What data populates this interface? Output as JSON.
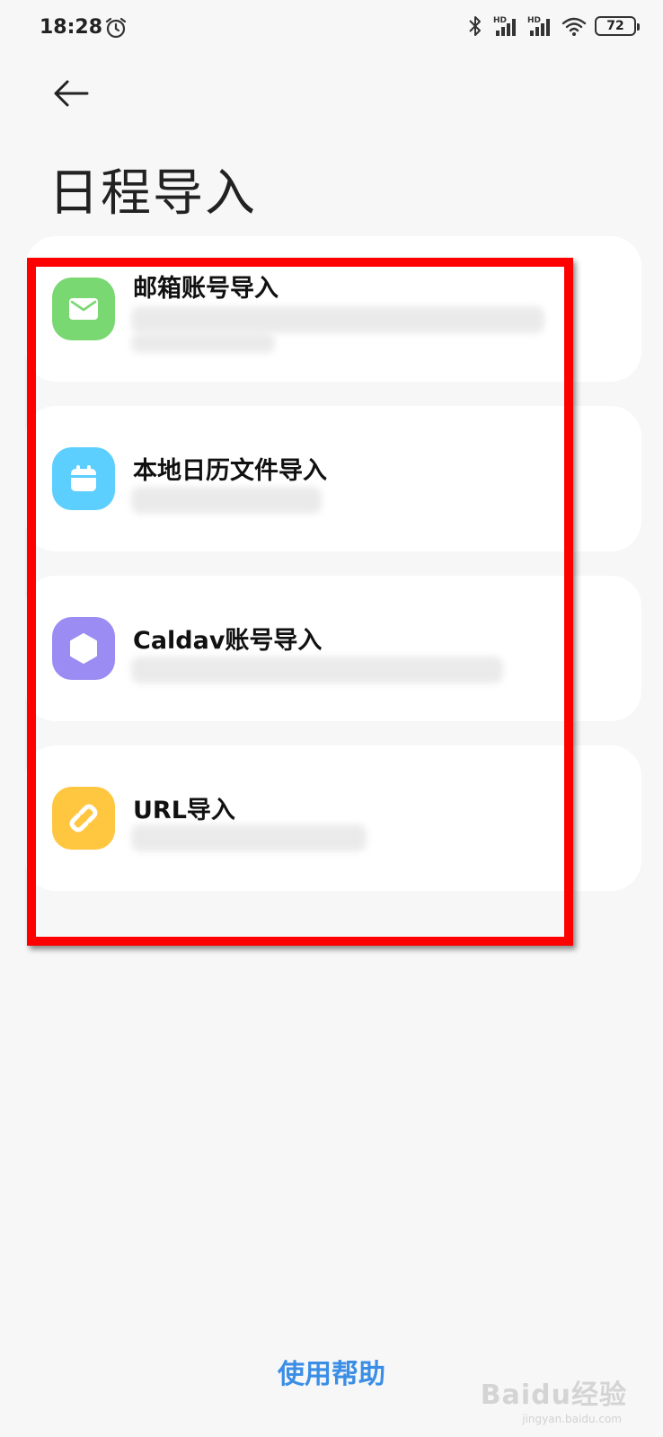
{
  "status_bar": {
    "time": "18:28",
    "network_labels": [
      "HD",
      "HD"
    ],
    "battery": "72"
  },
  "header": {
    "title": "日程导入"
  },
  "import_options": [
    {
      "title": "邮箱账号导入",
      "icon": "mail-icon",
      "color": "#7ad872"
    },
    {
      "title": "本地日历文件导入",
      "icon": "calendar-icon",
      "color": "#5ccfff"
    },
    {
      "title": "Caldav账号导入",
      "icon": "hexagon-icon",
      "color": "#9a8cf3"
    },
    {
      "title": "URL导入",
      "icon": "link-icon",
      "color": "#ffc640"
    }
  ],
  "footer": {
    "help_label": "使用帮助"
  },
  "watermark": {
    "brand": "Baidu经验",
    "url": "jingyan.baidu.com"
  }
}
